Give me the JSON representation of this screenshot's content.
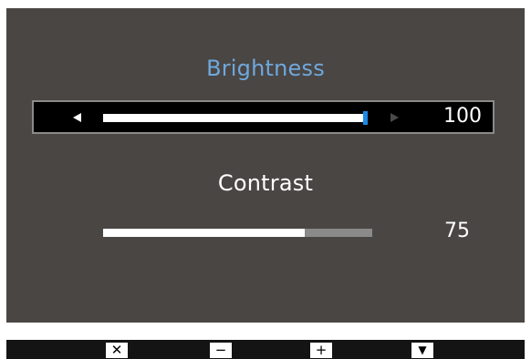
{
  "brightness": {
    "label": "Brightness",
    "value": "100",
    "level": 1.0,
    "color": "#6fa8dc"
  },
  "contrast": {
    "label": "Contrast",
    "value": "75",
    "level": 0.75
  },
  "buttons": {
    "close": "✕",
    "minus": "−",
    "plus": "+",
    "down": "▼"
  },
  "colors": {
    "panel": "#4a4644",
    "accent": "#1e88e5",
    "bar": "#141414"
  }
}
